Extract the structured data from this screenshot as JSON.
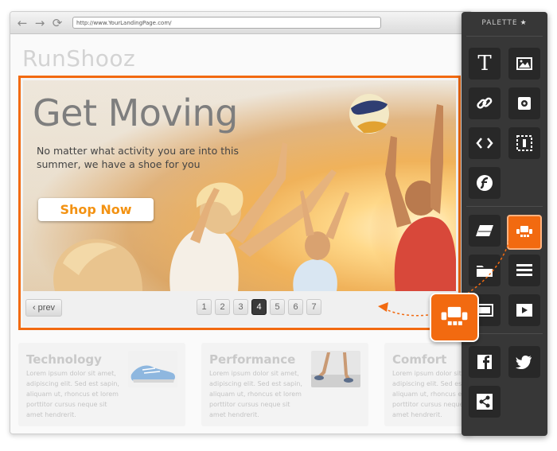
{
  "browser": {
    "url": "http://www.YourLandingPage.com/",
    "back_glyph": "←",
    "forward_glyph": "→",
    "reload_glyph": "⟳"
  },
  "site": {
    "logo": "RunShooz"
  },
  "hero": {
    "title": "Get Moving",
    "subtitle": "No matter what activity you are into this summer, we have a shoe for you",
    "cta": "Shop Now"
  },
  "pagination": {
    "prev": "‹ prev",
    "pages": [
      "1",
      "2",
      "3",
      "4",
      "5",
      "6",
      "7"
    ],
    "active": "4"
  },
  "features": [
    {
      "title": "Technology",
      "text": "Lorem ipsum dolor sit amet, adipiscing elit. Sed est sapin, aliquam ut, rhoncus et lorem porttitor cursus neque sit amet hendrerit."
    },
    {
      "title": "Performance",
      "text": "Lorem ipsum dolor sit amet, adipiscing elit. Sed est sapin, aliquam ut, rhoncus et lorem porttitor cursus neque sit amet hendrerit."
    },
    {
      "title": "Comfort",
      "text": "Lorem ipsum dolor sit amet, adipiscing elit. Sed est sapin, aliquam ut, rhoncus et lorem porttitor cursus neque sit amet hendrerit."
    }
  ],
  "palette": {
    "title": "PALETTE",
    "pin_glyph": "★",
    "text_tool_glyph": "T",
    "tools": [
      "text-icon",
      "image-icon",
      "link-icon",
      "widget-icon",
      "code-icon",
      "form-icon",
      "flash-icon",
      "layer-icon",
      "slider-icon",
      "folder-icon",
      "list-icon",
      "banner-icon",
      "video-icon",
      "facebook-icon",
      "twitter-icon",
      "share-icon"
    ],
    "selected_tool": "slider-icon"
  },
  "colors": {
    "accent": "#f26a10",
    "palette_bg": "#373737",
    "tool_bg": "#282828"
  }
}
